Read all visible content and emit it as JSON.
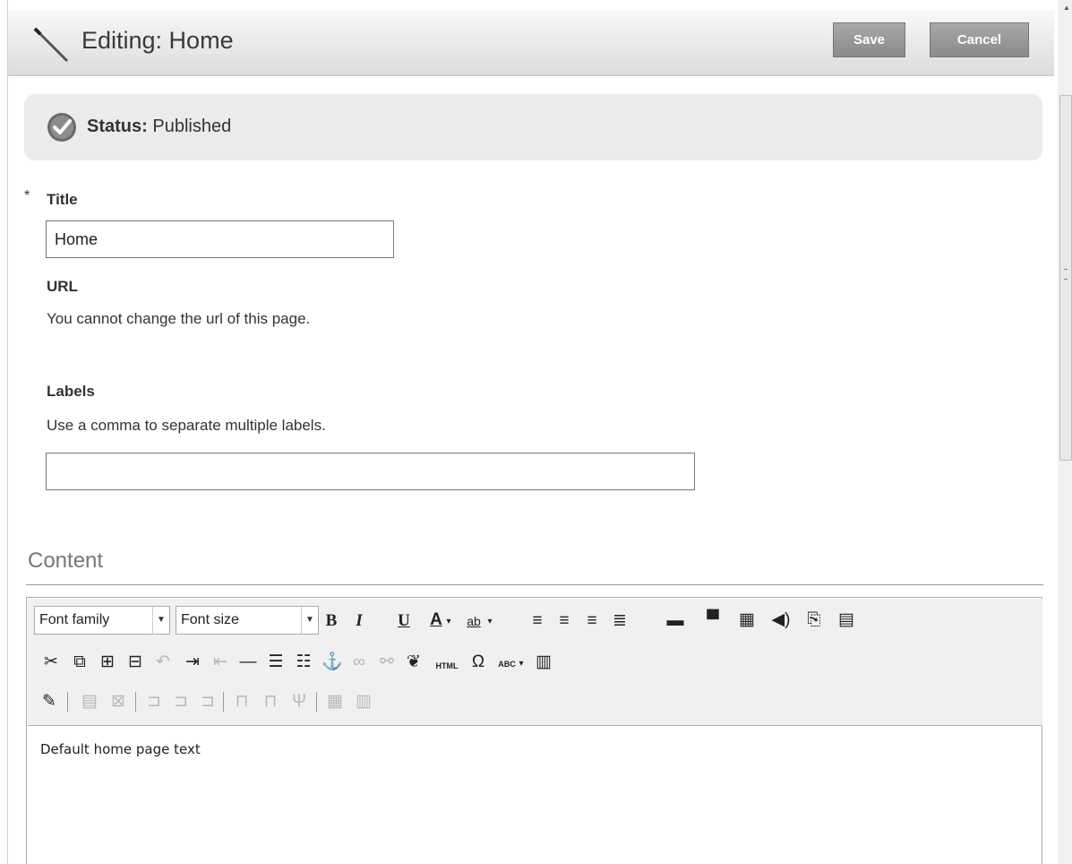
{
  "header": {
    "title": "Editing: Home",
    "save_label": "Save",
    "cancel_label": "Cancel"
  },
  "status": {
    "label": "Status:",
    "value": "Published"
  },
  "form": {
    "required_marker": "*",
    "title_label": "Title",
    "title_value": "Home",
    "url_label": "URL",
    "url_help": "You cannot change the url of this page.",
    "labels_label": "Labels",
    "labels_help": "Use a comma to separate multiple labels.",
    "labels_value": ""
  },
  "content": {
    "heading": "Content",
    "font_family": "Font family",
    "font_size": "Font size",
    "body_text": "Default home page text"
  },
  "toolbar_icons": {
    "html_label": "HTML",
    "abc_label": "ABC",
    "ab_label": "ab"
  }
}
